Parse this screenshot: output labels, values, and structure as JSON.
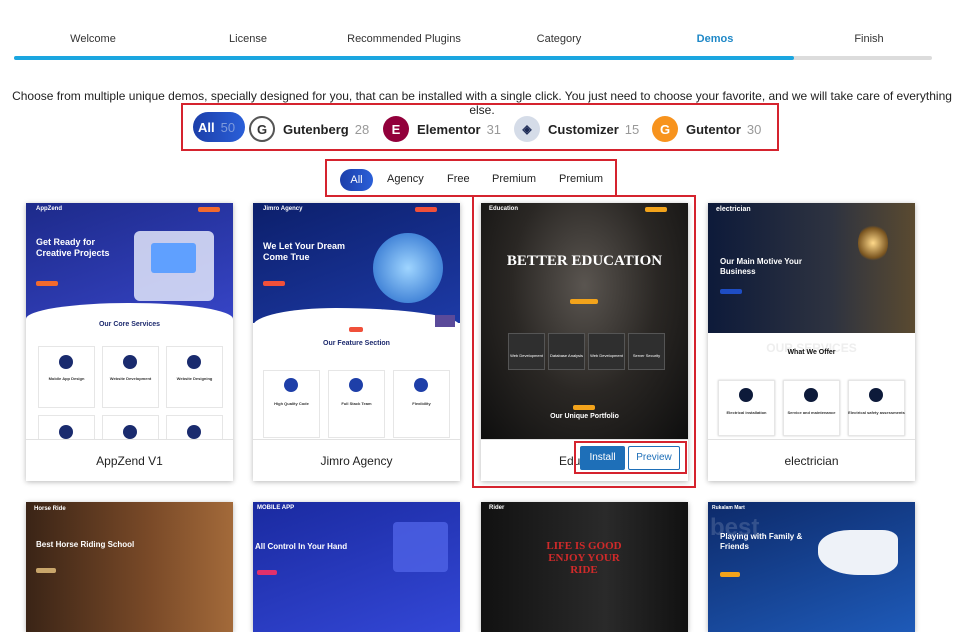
{
  "steps": [
    "Welcome",
    "License",
    "Recommended Plugins",
    "Category",
    "Demos",
    "Finish"
  ],
  "active_step": "Demos",
  "progress": 0.85,
  "intro": "Choose from multiple unique demos, specially designed for you, that can be installed with a single click. You just need to choose your favorite, and we will take care of everything else.",
  "builders": [
    {
      "label": "All",
      "count": "50"
    },
    {
      "label": "Gutenberg",
      "count": "28"
    },
    {
      "label": "Elementor",
      "count": "31"
    },
    {
      "label": "Customizer",
      "count": "15"
    },
    {
      "label": "Gutentor",
      "count": "30"
    }
  ],
  "categories": [
    "All",
    "Agency",
    "Free",
    "Premium",
    "Premium"
  ],
  "demos": [
    {
      "name": "AppZend V1",
      "brand": "AppZend",
      "hero": "Get Ready for Creative Projects",
      "section": "Our Core Services",
      "items": [
        "Mobile App Design",
        "Website Development",
        "Website Designing"
      ],
      "nav_btn": "BUY NOW"
    },
    {
      "name": "Jimro Agency",
      "brand": "Jimro Agency",
      "hero": "We Let Your Dream Come True",
      "section": "Our Feature Section",
      "items": [
        "High Quality Code",
        "Full Stack Team",
        "Flexibility"
      ],
      "badge": "FEATURE"
    },
    {
      "name": "Education",
      "name_visible": "Edu",
      "brand": "Education",
      "hero": "BETTER EDUCATION",
      "section": "Our Unique Portfolio",
      "items": [
        "Web Development",
        "Database Analysis",
        "Web Development",
        "Server Security"
      ],
      "install": "Install",
      "preview": "Preview"
    },
    {
      "name": "electrician",
      "brand": "electrician",
      "hero": "Our Main Motive Your Business",
      "section": "What We Offer",
      "watermark": "OUR SERVICES",
      "items": [
        "Electrical installation",
        "Service and maintenance",
        "Electrical safety assessments"
      ]
    },
    {
      "brand": "Horse Ride",
      "hero": "Best Horse Riding School"
    },
    {
      "brand": "MOBILE APP",
      "hero": "All Control In Your Hand"
    },
    {
      "brand": "Rider",
      "hero": "LIFE IS GOOD ENJOY YOUR RIDE"
    },
    {
      "brand": "Rukalam Mart",
      "hero": "Playing with Family & Friends",
      "watermark": "best"
    }
  ],
  "colors": {
    "accent": "#1e88c7",
    "progress": "#1ba6e0",
    "pill": "#1c3faa",
    "highlight": "#d5232e",
    "button": "#1e6fb8"
  },
  "icons": {
    "gutenberg": "gutenberg-logo",
    "elementor": "elementor-logo",
    "customizer": "customizer-logo",
    "gutentor": "gutentor-logo"
  }
}
